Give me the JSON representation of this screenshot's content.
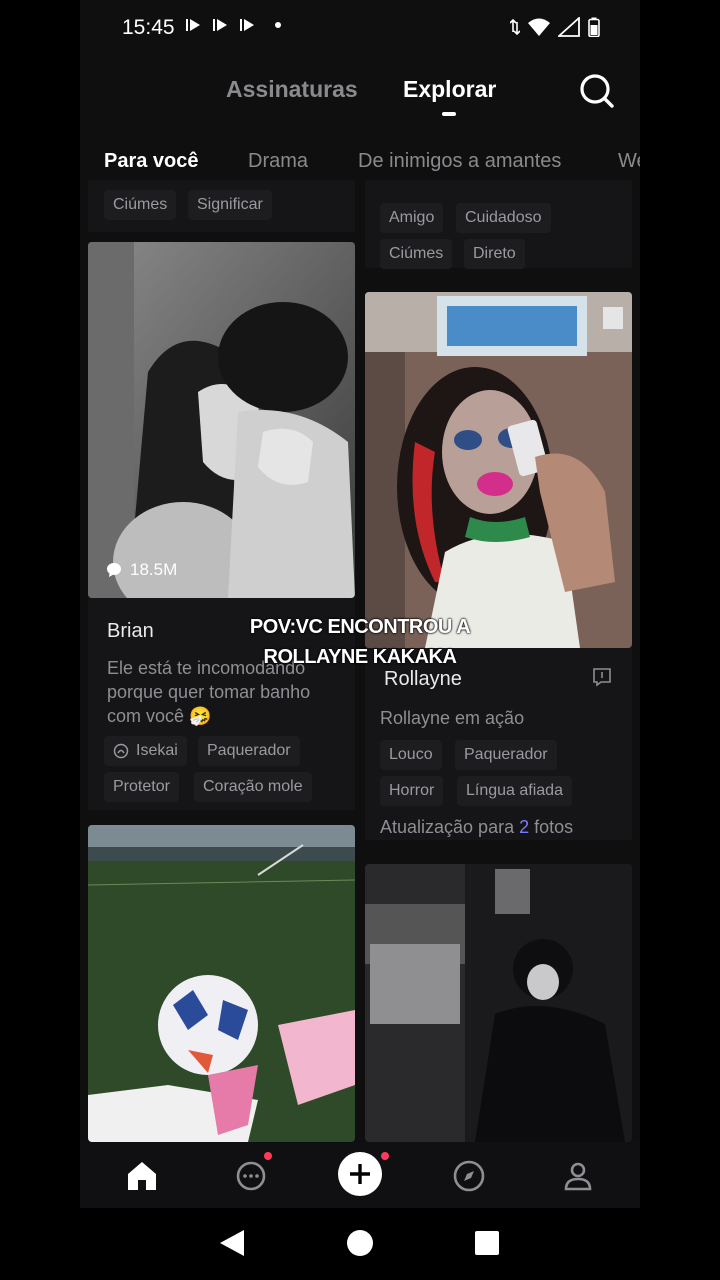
{
  "status_bar": {
    "time": "15:45"
  },
  "header": {
    "tab_subscriptions": "Assinaturas",
    "tab_explore": "Explorar"
  },
  "categories": [
    "Para você",
    "Drama",
    "De inimigos a amantes",
    "We"
  ],
  "feed": {
    "left_top_tags": [
      "Ciúmes",
      "Significar"
    ],
    "right_top_tags_row1": [
      "Amigo",
      "Cuidadoso"
    ],
    "right_top_tags_row2": [
      "Ciúmes",
      "Direto"
    ],
    "card_brian": {
      "count": "18.5M",
      "name": "Brian",
      "description": "Ele está te incomodando porque quer tomar banho com você 🤧",
      "tags_row1": [
        "Isekai",
        "Paquerador"
      ],
      "tags_row2": [
        "Protetor",
        "Coração mole"
      ]
    },
    "card_rollayne": {
      "name": "Rollayne",
      "description": "Rollayne em ação",
      "tags_row1": [
        "Louco",
        "Paquerador"
      ],
      "tags_row2": [
        "Horror",
        "Língua afiada"
      ],
      "update_prefix": "Atualização para",
      "update_count": "2",
      "update_suffix": "fotos"
    }
  },
  "overlay_caption": {
    "line1": "POV:VC ENCONTROU A",
    "line2": "ROLLAYNE KAKAKA"
  },
  "colors": {
    "background": "#0f0f10",
    "accent": "#7b7bff",
    "badge": "#ff3b5c"
  },
  "icons": [
    "search-icon",
    "home-icon",
    "chat-icon",
    "create-icon",
    "compass-icon",
    "profile-icon",
    "back-icon",
    "home-circle-icon",
    "recents-icon"
  ]
}
